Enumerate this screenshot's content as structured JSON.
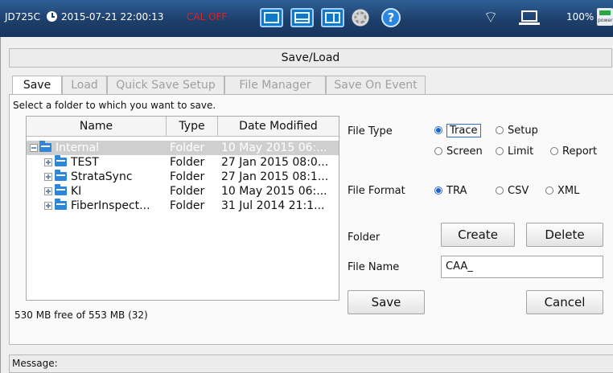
{
  "status_bar": {
    "model": "JD725C",
    "datetime": "2015-07-21 22:00:13",
    "cal_status": "CAL OFF",
    "battery": "100%",
    "icons": [
      "clock-icon",
      "single-view-icon",
      "split-horizontal-icon",
      "split-vertical-icon",
      "settings-gear-icon",
      "help-icon",
      "wifi-icon",
      "laptop-icon",
      "power-icon"
    ]
  },
  "window": {
    "title": "Save/Load"
  },
  "tabs": [
    {
      "label": "Save",
      "active": true
    },
    {
      "label": "Load",
      "active": false
    },
    {
      "label": "Quick Save Setup",
      "active": false
    },
    {
      "label": "File Manager",
      "active": false
    },
    {
      "label": "Save On Event",
      "active": false
    }
  ],
  "save_panel": {
    "instruction": "Select a folder to which you want to save.",
    "columns": [
      "Name",
      "Type",
      "Date Modified"
    ],
    "folders": [
      {
        "name": "Internal",
        "type": "Folder",
        "date": "10 May 2015 06:...",
        "selected": true,
        "expander": "minus",
        "indent": 0
      },
      {
        "name": "TEST",
        "type": "Folder",
        "date": "27 Jan 2015 08:0...",
        "selected": false,
        "expander": "plus",
        "indent": 1
      },
      {
        "name": "StrataSync",
        "type": "Folder",
        "date": "27 Jan 2015 08:1...",
        "selected": false,
        "expander": "plus",
        "indent": 1
      },
      {
        "name": "KI",
        "type": "Folder",
        "date": "10 May 2015 06:...",
        "selected": false,
        "expander": "plus",
        "indent": 1
      },
      {
        "name": "FiberInspect...",
        "type": "Folder",
        "date": "31 Jul 2014 21:1...",
        "selected": false,
        "expander": "plus",
        "indent": 1
      }
    ],
    "free_space": "530 MB free of 553 MB (32)",
    "file_type": {
      "label": "File Type",
      "options": [
        "Trace",
        "Setup",
        "Screen",
        "Limit",
        "Report"
      ],
      "selected": "Trace"
    },
    "file_format": {
      "label": "File Format",
      "options": [
        "TRA",
        "CSV",
        "XML"
      ],
      "selected": "TRA"
    },
    "folder": {
      "label": "Folder",
      "create_label": "Create",
      "delete_label": "Delete"
    },
    "file_name": {
      "label": "File Name",
      "value": "CAA_"
    },
    "save_label": "Save",
    "cancel_label": "Cancel"
  },
  "message": {
    "label": "Message:"
  },
  "colors": {
    "status_bar": "#1d3f6a",
    "cal_off": "#e02020",
    "radio_selected": "#1d5fc8",
    "selected_row": "#cfcfcf"
  }
}
